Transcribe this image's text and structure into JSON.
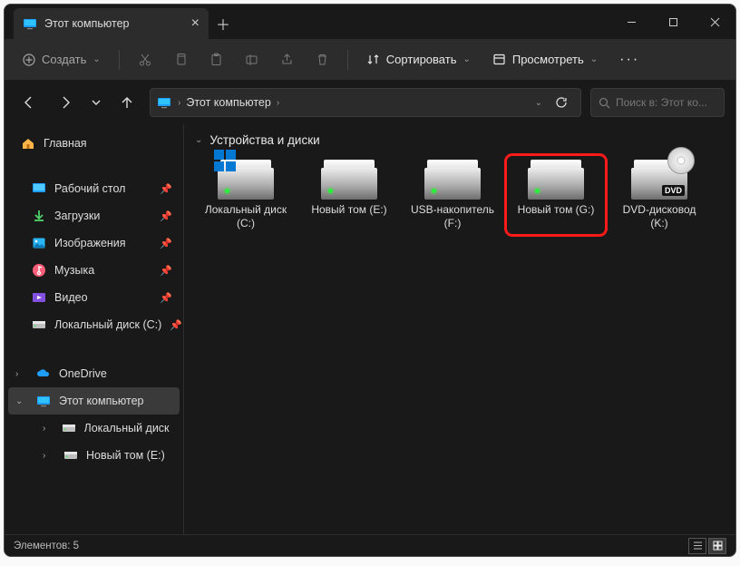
{
  "tab": {
    "title": "Этот компьютер"
  },
  "toolbar": {
    "create": "Создать",
    "sort": "Сортировать",
    "view": "Просмотреть"
  },
  "breadcrumb": {
    "segment": "Этот компьютер"
  },
  "search": {
    "placeholder": "Поиск в: Этот ко..."
  },
  "sidebar": {
    "home": "Главная",
    "desktop": "Рабочий стол",
    "downloads": "Загрузки",
    "pictures": "Изображения",
    "music": "Музыка",
    "videos": "Видео",
    "localc": "Локальный диск (C:)",
    "onedrive": "OneDrive",
    "thispc": "Этот компьютер",
    "sub_localc": "Локальный диск (C:)",
    "sub_newe": "Новый том (E:)"
  },
  "group": {
    "title": "Устройства и диски"
  },
  "drives": {
    "c": {
      "l1": "Локальный диск",
      "l2": "(C:)"
    },
    "e": {
      "l1": "Новый том (E:)",
      "l2": ""
    },
    "f": {
      "l1": "USB-накопитель",
      "l2": "(F:)"
    },
    "g": {
      "l1": "Новый том (G:)",
      "l2": ""
    },
    "k": {
      "l1": "DVD-дисковод",
      "l2": "(K:)"
    }
  },
  "status": {
    "count": "Элементов: 5"
  }
}
